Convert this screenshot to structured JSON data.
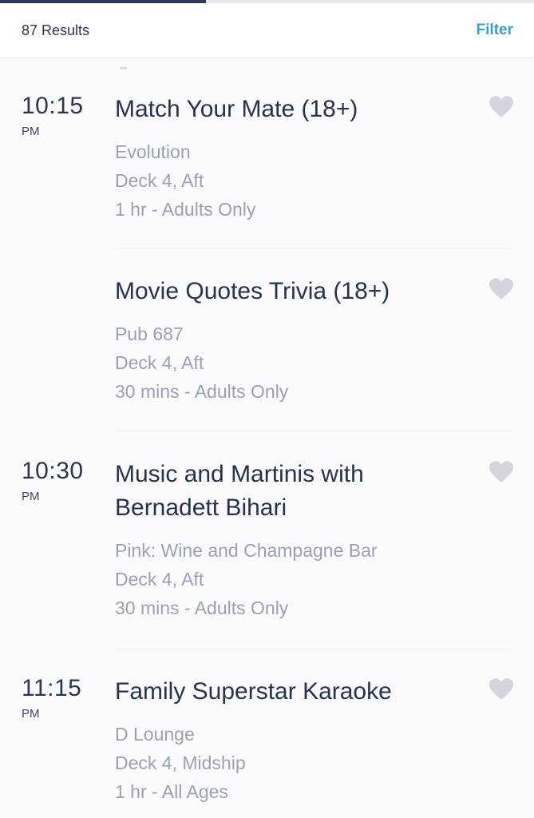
{
  "header": {
    "results_label": "87 Results",
    "filter_label": "Filter",
    "progress_fraction": 0.385
  },
  "colors": {
    "accent": "#3aa0c4",
    "title_text": "#26324e",
    "meta_text": "#9aa1b4",
    "heart": "#d3d6de",
    "background": "#fbfbfd"
  },
  "events": [
    {
      "time": "10:15",
      "ampm": "PM",
      "title": "Match Your Mate (18+)",
      "venue": "Evolution",
      "deck": "Deck 4, Aft",
      "duration": "1 hr - Adults Only",
      "icon": "heart-icon"
    },
    {
      "time": "",
      "ampm": "",
      "title": "Movie Quotes Trivia (18+)",
      "venue": "Pub 687",
      "deck": "Deck 4, Aft",
      "duration": "30 mins - Adults Only",
      "icon": "heart-icon"
    },
    {
      "time": "10:30",
      "ampm": "PM",
      "title": "Music and Martinis with Bernadett Bihari",
      "venue": "Pink: Wine and Champagne Bar",
      "deck": "Deck 4, Aft",
      "duration": "30 mins - Adults Only",
      "icon": "heart-icon"
    },
    {
      "time": "11:15",
      "ampm": "PM",
      "title": "Family Superstar Karaoke",
      "venue": "D Lounge",
      "deck": "Deck 4, Midship",
      "duration": "1 hr - All Ages",
      "icon": "heart-icon"
    }
  ]
}
